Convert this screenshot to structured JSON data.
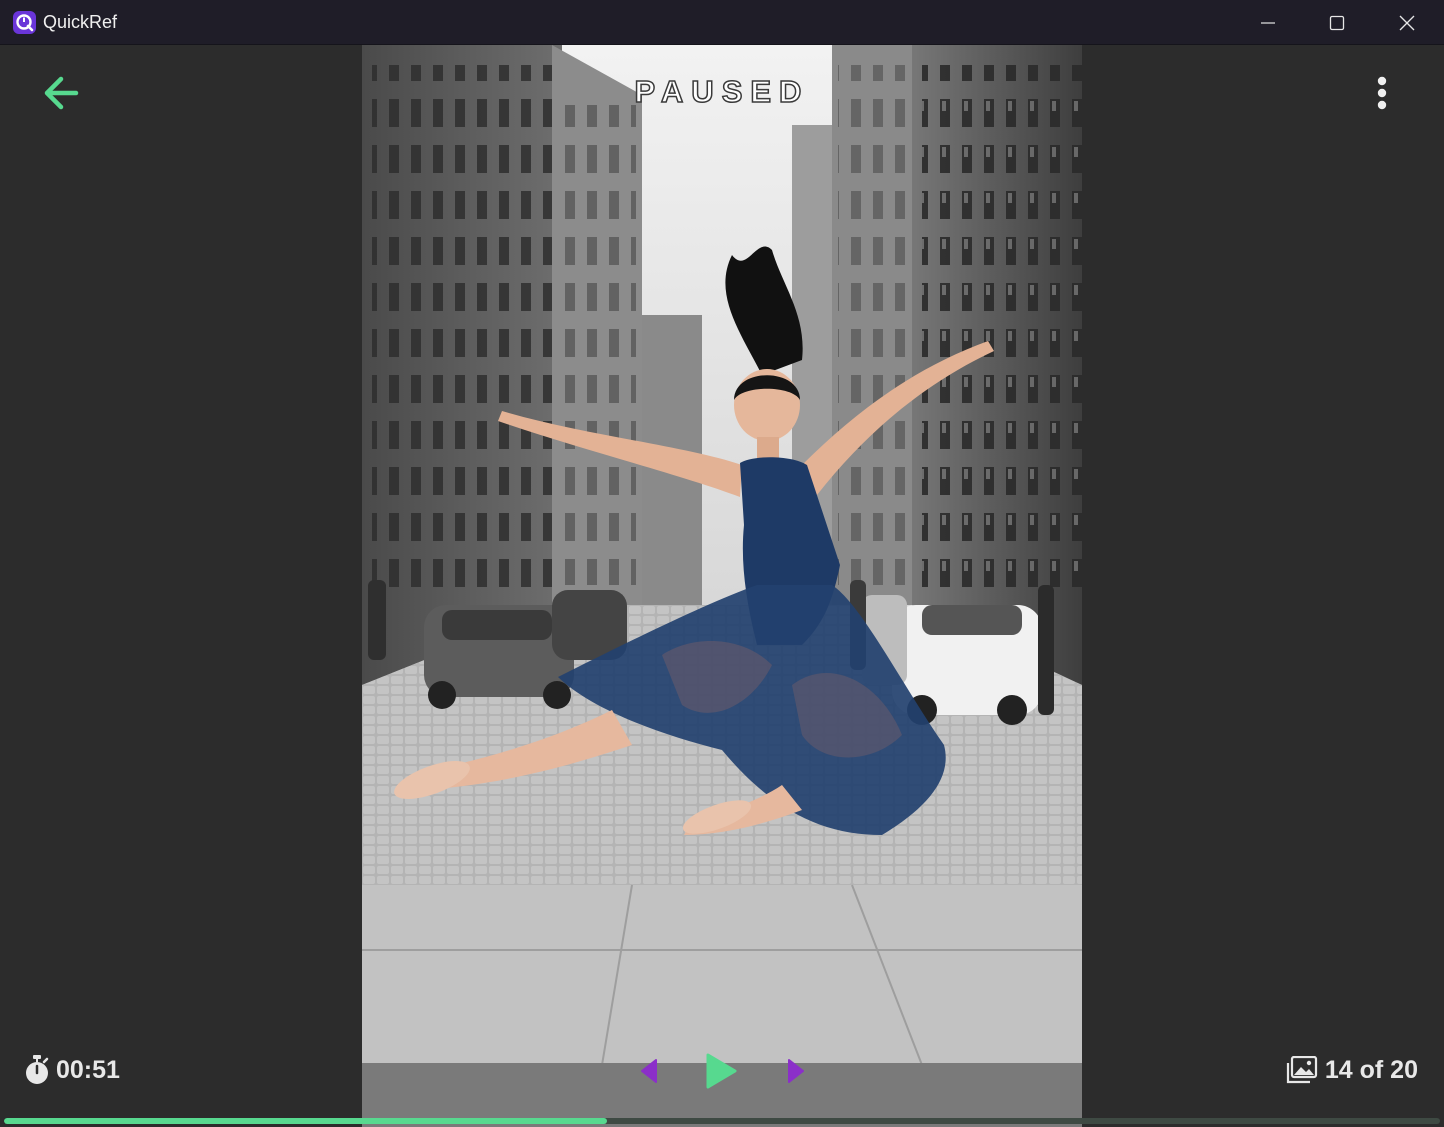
{
  "window": {
    "title": "QuickRef",
    "icon": "quickref-app-icon",
    "controls": [
      "minimize-icon",
      "maximize-icon",
      "close-icon"
    ]
  },
  "viewer": {
    "status_label": "PAUSED",
    "back_icon": "arrow-left-icon",
    "menu_icon": "more-vertical-icon",
    "accent_color": "#57d98f",
    "nav_color": "#8b2fc9"
  },
  "footer": {
    "timer_icon": "stopwatch-icon",
    "timer": "00:51",
    "gallery_icon": "gallery-icon",
    "counter": "14 of 20",
    "prev_icon": "prev-triangle-icon",
    "play_icon": "play-icon",
    "next_icon": "next-triangle-icon"
  },
  "progress": {
    "fraction": 0.42
  },
  "image": {
    "subject": "dancer-leaping-in-city-street"
  }
}
